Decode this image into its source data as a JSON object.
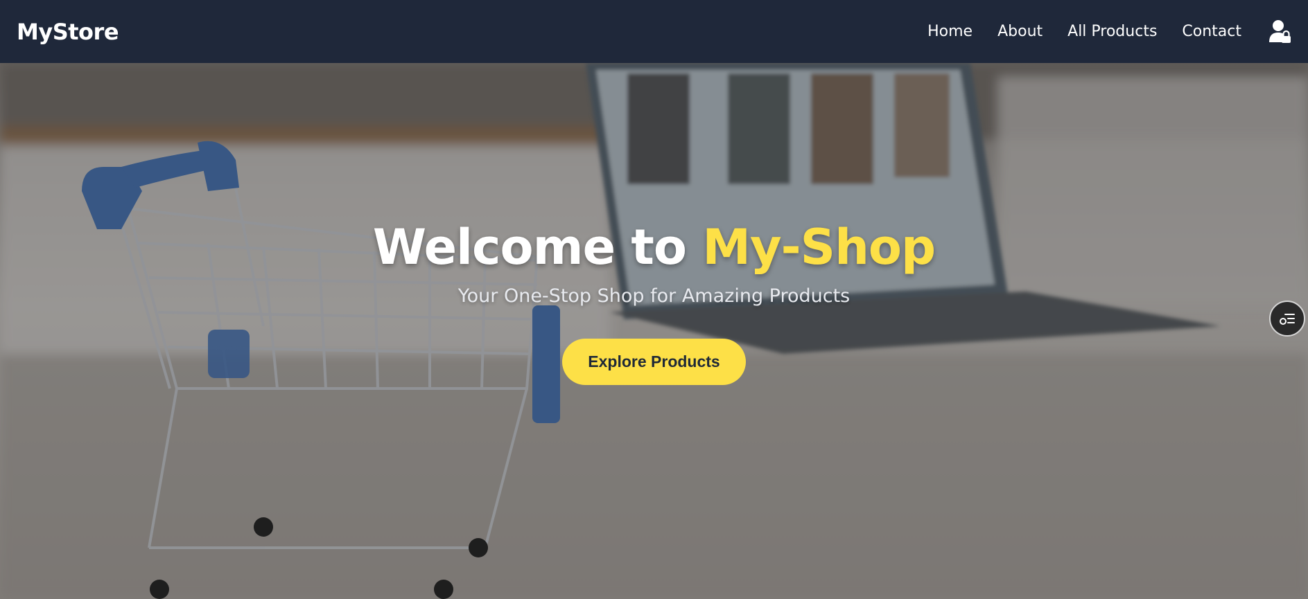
{
  "navbar": {
    "brand": "MyStore",
    "links": [
      "Home",
      "About",
      "All Products",
      "Contact"
    ],
    "user_icon": "user-lock-icon"
  },
  "hero": {
    "title_part1": "Welcome to ",
    "title_accent": "My-Shop",
    "subtitle": "Your One-Stop Shop for Amazing Products",
    "cta_label": "Explore Products"
  },
  "side_button": {
    "icon": "list-settings-icon"
  },
  "colors": {
    "navbar_bg": "#1f283a",
    "accent": "#fde047",
    "text_light": "#ffffff",
    "cta_text": "#1f2937"
  }
}
